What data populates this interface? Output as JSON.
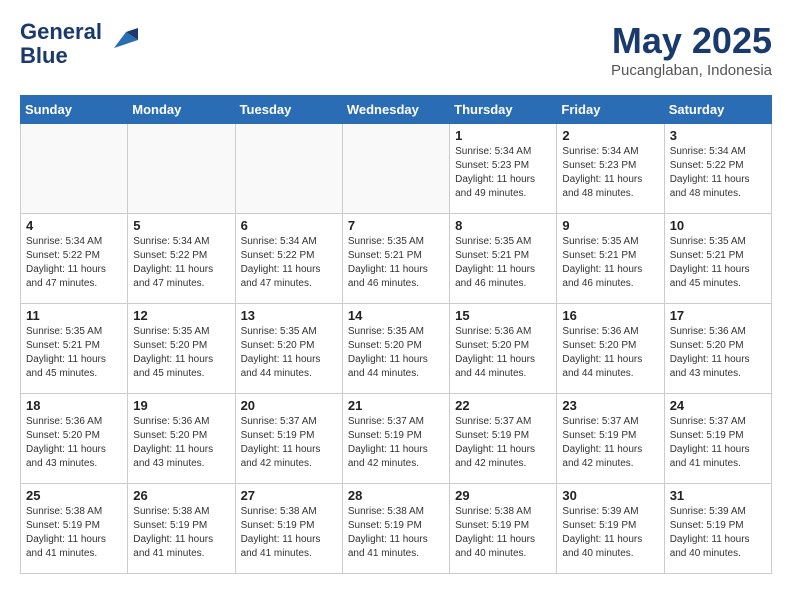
{
  "header": {
    "logo_line1": "General",
    "logo_line2": "Blue",
    "month_title": "May 2025",
    "location": "Pucanglaban, Indonesia"
  },
  "weekdays": [
    "Sunday",
    "Monday",
    "Tuesday",
    "Wednesday",
    "Thursday",
    "Friday",
    "Saturday"
  ],
  "weeks": [
    [
      {
        "day": "",
        "empty": true
      },
      {
        "day": "",
        "empty": true
      },
      {
        "day": "",
        "empty": true
      },
      {
        "day": "",
        "empty": true
      },
      {
        "day": "1",
        "sunrise": "Sunrise: 5:34 AM",
        "sunset": "Sunset: 5:23 PM",
        "daylight": "Daylight: 11 hours and 49 minutes."
      },
      {
        "day": "2",
        "sunrise": "Sunrise: 5:34 AM",
        "sunset": "Sunset: 5:23 PM",
        "daylight": "Daylight: 11 hours and 48 minutes."
      },
      {
        "day": "3",
        "sunrise": "Sunrise: 5:34 AM",
        "sunset": "Sunset: 5:22 PM",
        "daylight": "Daylight: 11 hours and 48 minutes."
      }
    ],
    [
      {
        "day": "4",
        "sunrise": "Sunrise: 5:34 AM",
        "sunset": "Sunset: 5:22 PM",
        "daylight": "Daylight: 11 hours and 47 minutes."
      },
      {
        "day": "5",
        "sunrise": "Sunrise: 5:34 AM",
        "sunset": "Sunset: 5:22 PM",
        "daylight": "Daylight: 11 hours and 47 minutes."
      },
      {
        "day": "6",
        "sunrise": "Sunrise: 5:34 AM",
        "sunset": "Sunset: 5:22 PM",
        "daylight": "Daylight: 11 hours and 47 minutes."
      },
      {
        "day": "7",
        "sunrise": "Sunrise: 5:35 AM",
        "sunset": "Sunset: 5:21 PM",
        "daylight": "Daylight: 11 hours and 46 minutes."
      },
      {
        "day": "8",
        "sunrise": "Sunrise: 5:35 AM",
        "sunset": "Sunset: 5:21 PM",
        "daylight": "Daylight: 11 hours and 46 minutes."
      },
      {
        "day": "9",
        "sunrise": "Sunrise: 5:35 AM",
        "sunset": "Sunset: 5:21 PM",
        "daylight": "Daylight: 11 hours and 46 minutes."
      },
      {
        "day": "10",
        "sunrise": "Sunrise: 5:35 AM",
        "sunset": "Sunset: 5:21 PM",
        "daylight": "Daylight: 11 hours and 45 minutes."
      }
    ],
    [
      {
        "day": "11",
        "sunrise": "Sunrise: 5:35 AM",
        "sunset": "Sunset: 5:21 PM",
        "daylight": "Daylight: 11 hours and 45 minutes."
      },
      {
        "day": "12",
        "sunrise": "Sunrise: 5:35 AM",
        "sunset": "Sunset: 5:20 PM",
        "daylight": "Daylight: 11 hours and 45 minutes."
      },
      {
        "day": "13",
        "sunrise": "Sunrise: 5:35 AM",
        "sunset": "Sunset: 5:20 PM",
        "daylight": "Daylight: 11 hours and 44 minutes."
      },
      {
        "day": "14",
        "sunrise": "Sunrise: 5:35 AM",
        "sunset": "Sunset: 5:20 PM",
        "daylight": "Daylight: 11 hours and 44 minutes."
      },
      {
        "day": "15",
        "sunrise": "Sunrise: 5:36 AM",
        "sunset": "Sunset: 5:20 PM",
        "daylight": "Daylight: 11 hours and 44 minutes."
      },
      {
        "day": "16",
        "sunrise": "Sunrise: 5:36 AM",
        "sunset": "Sunset: 5:20 PM",
        "daylight": "Daylight: 11 hours and 44 minutes."
      },
      {
        "day": "17",
        "sunrise": "Sunrise: 5:36 AM",
        "sunset": "Sunset: 5:20 PM",
        "daylight": "Daylight: 11 hours and 43 minutes."
      }
    ],
    [
      {
        "day": "18",
        "sunrise": "Sunrise: 5:36 AM",
        "sunset": "Sunset: 5:20 PM",
        "daylight": "Daylight: 11 hours and 43 minutes."
      },
      {
        "day": "19",
        "sunrise": "Sunrise: 5:36 AM",
        "sunset": "Sunset: 5:20 PM",
        "daylight": "Daylight: 11 hours and 43 minutes."
      },
      {
        "day": "20",
        "sunrise": "Sunrise: 5:37 AM",
        "sunset": "Sunset: 5:19 PM",
        "daylight": "Daylight: 11 hours and 42 minutes."
      },
      {
        "day": "21",
        "sunrise": "Sunrise: 5:37 AM",
        "sunset": "Sunset: 5:19 PM",
        "daylight": "Daylight: 11 hours and 42 minutes."
      },
      {
        "day": "22",
        "sunrise": "Sunrise: 5:37 AM",
        "sunset": "Sunset: 5:19 PM",
        "daylight": "Daylight: 11 hours and 42 minutes."
      },
      {
        "day": "23",
        "sunrise": "Sunrise: 5:37 AM",
        "sunset": "Sunset: 5:19 PM",
        "daylight": "Daylight: 11 hours and 42 minutes."
      },
      {
        "day": "24",
        "sunrise": "Sunrise: 5:37 AM",
        "sunset": "Sunset: 5:19 PM",
        "daylight": "Daylight: 11 hours and 41 minutes."
      }
    ],
    [
      {
        "day": "25",
        "sunrise": "Sunrise: 5:38 AM",
        "sunset": "Sunset: 5:19 PM",
        "daylight": "Daylight: 11 hours and 41 minutes."
      },
      {
        "day": "26",
        "sunrise": "Sunrise: 5:38 AM",
        "sunset": "Sunset: 5:19 PM",
        "daylight": "Daylight: 11 hours and 41 minutes."
      },
      {
        "day": "27",
        "sunrise": "Sunrise: 5:38 AM",
        "sunset": "Sunset: 5:19 PM",
        "daylight": "Daylight: 11 hours and 41 minutes."
      },
      {
        "day": "28",
        "sunrise": "Sunrise: 5:38 AM",
        "sunset": "Sunset: 5:19 PM",
        "daylight": "Daylight: 11 hours and 41 minutes."
      },
      {
        "day": "29",
        "sunrise": "Sunrise: 5:38 AM",
        "sunset": "Sunset: 5:19 PM",
        "daylight": "Daylight: 11 hours and 40 minutes."
      },
      {
        "day": "30",
        "sunrise": "Sunrise: 5:39 AM",
        "sunset": "Sunset: 5:19 PM",
        "daylight": "Daylight: 11 hours and 40 minutes."
      },
      {
        "day": "31",
        "sunrise": "Sunrise: 5:39 AM",
        "sunset": "Sunset: 5:19 PM",
        "daylight": "Daylight: 11 hours and 40 minutes."
      }
    ]
  ]
}
